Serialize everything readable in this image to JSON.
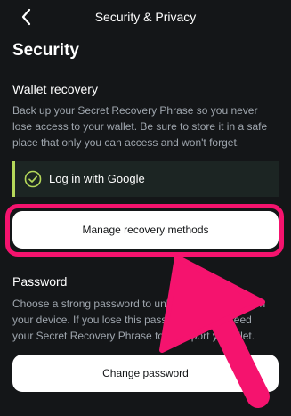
{
  "header": {
    "title": "Security & Privacy",
    "back_icon": "chevron-left-icon"
  },
  "security": {
    "title": "Security",
    "wallet_recovery": {
      "title": "Wallet recovery",
      "description": "Back up your Secret Recovery Phrase so you never lose access to your wallet. Be sure to store it in a safe place that only you can access and won't forget.",
      "status_label": "Log in with Google",
      "status_icon": "check-circle-icon",
      "status_color": "#b5d85a",
      "manage_label": "Manage recovery methods"
    },
    "password": {
      "title": "Password",
      "description_line1": "Choose a strong password to unlock",
      "description_line1_end": "sk app on",
      "description_line2": "your device. If you lose this password, yo",
      "description_line2_end": "eed",
      "description_line3": "your Secret Recovery Phrase to re-import y",
      "description_line3_end": "allet.",
      "change_label": "Change password"
    }
  },
  "annotation": {
    "highlight_color": "#f5136e",
    "arrow_icon": "arrow-up-left-icon"
  }
}
